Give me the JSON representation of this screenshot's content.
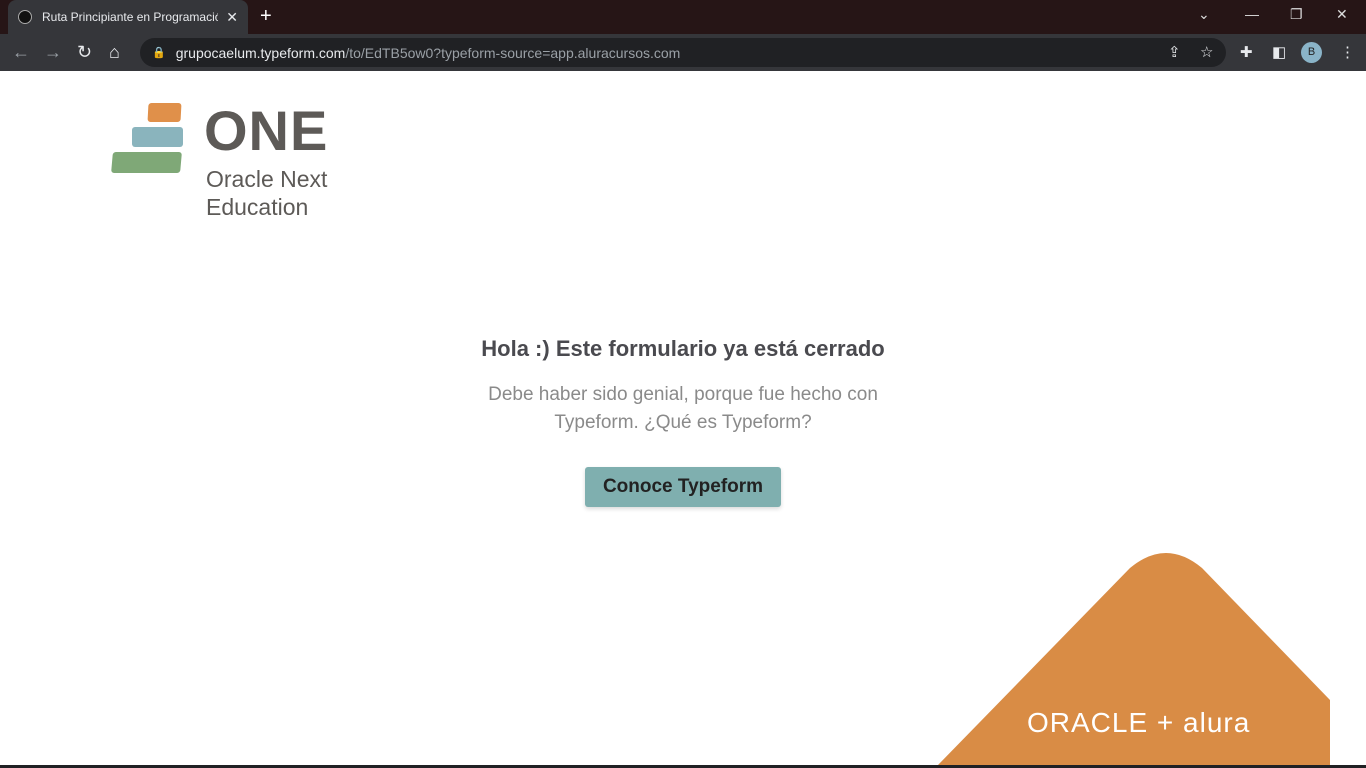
{
  "browser": {
    "tab_title": "Ruta Principiante en Programación",
    "url_host": "grupocaelum.typeform.com",
    "url_path": "/to/EdTB5ow0?typeform-source=app.aluracursos.com",
    "profile_initial": "B"
  },
  "logo": {
    "wordmark": "ONE",
    "subtitle_line1": "Oracle Next",
    "subtitle_line2": "Education",
    "colors": [
      "#e0904a",
      "#8ab4bd",
      "#7fa877"
    ]
  },
  "main": {
    "heading": "Hola :) Este formulario ya está cerrado",
    "text_line1": "Debe haber sido genial, porque fue hecho con",
    "text_line2": "Typeform. ¿Qué es Typeform?",
    "button": "Conoce Typeform"
  },
  "footer_brand": {
    "text": "ORACLE + alura",
    "color": "#d98c45"
  }
}
